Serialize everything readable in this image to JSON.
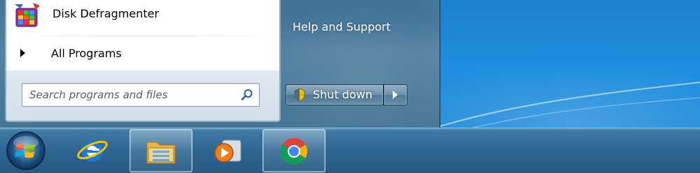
{
  "start_menu": {
    "pinned_program": {
      "label": "Disk Defragmenter",
      "icon": "disk-defragmenter-icon"
    },
    "all_programs_label": "All Programs",
    "search": {
      "placeholder": "Search programs and files",
      "value": ""
    },
    "right_pane": {
      "help_support_label": "Help and Support",
      "shutdown_label": "Shut down"
    }
  },
  "taskbar": {
    "items": [
      {
        "name": "internet-explorer",
        "icon": "internet-explorer-icon",
        "active": false
      },
      {
        "name": "windows-explorer",
        "icon": "folder-icon",
        "active": true
      },
      {
        "name": "windows-media-player",
        "icon": "media-player-icon",
        "active": false
      },
      {
        "name": "google-chrome",
        "icon": "chrome-icon",
        "active": true
      }
    ]
  },
  "colors": {
    "desktop_blue": "#1f8fdf",
    "taskbar_blue": "#2e6591",
    "menu_pane": "#ffffff"
  }
}
